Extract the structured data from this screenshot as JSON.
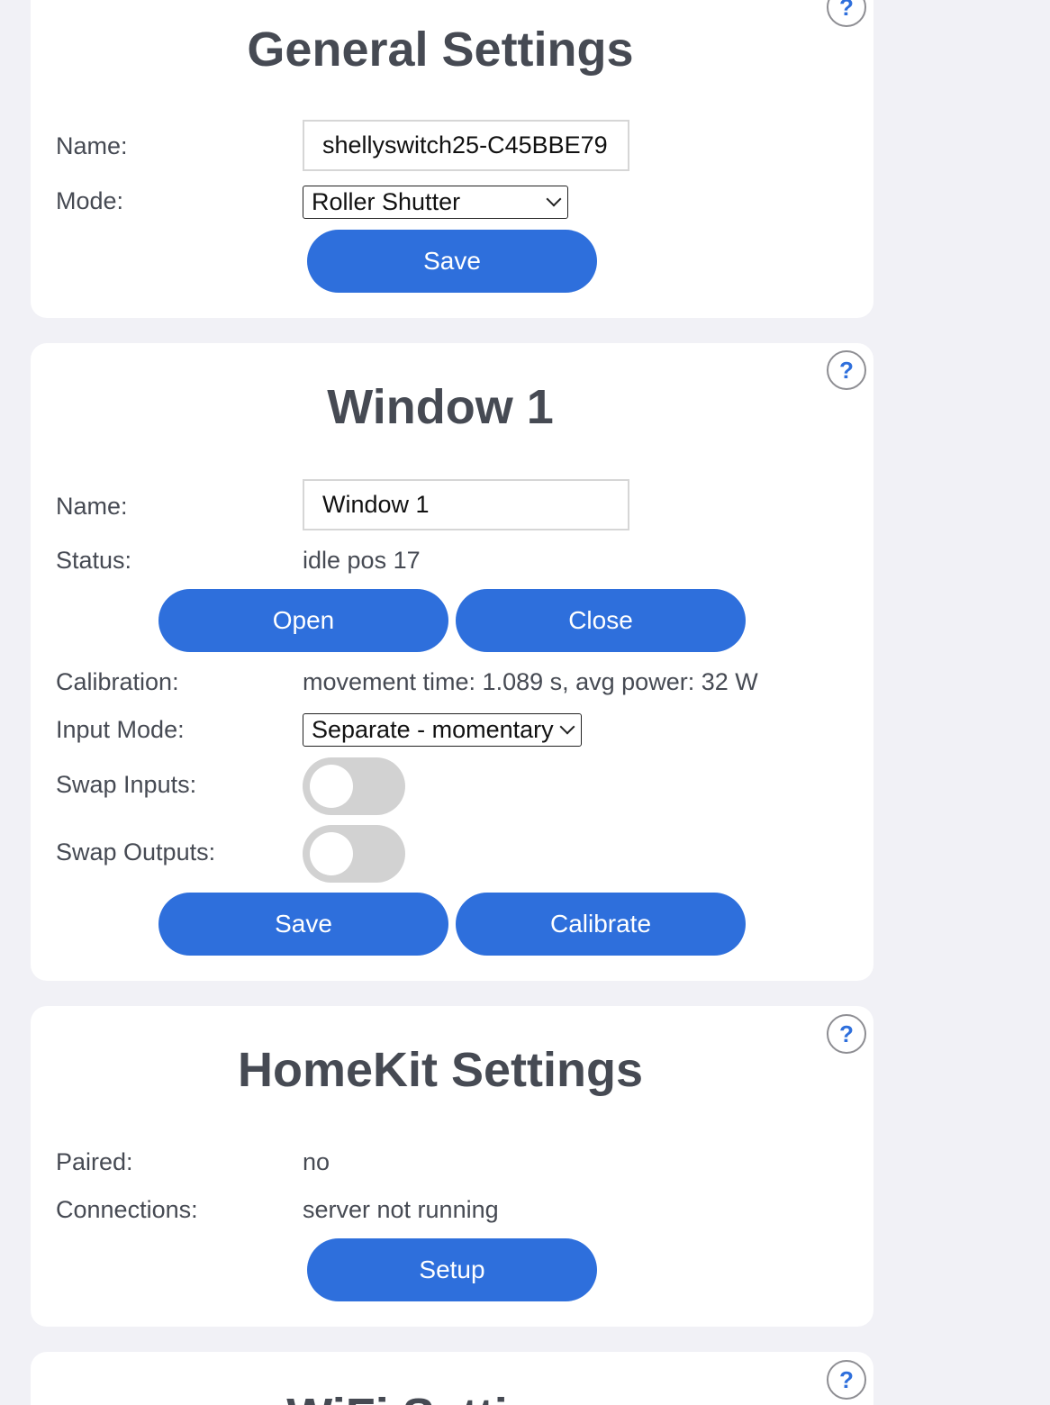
{
  "help_symbol": "?",
  "general": {
    "title": "General Settings",
    "name_label": "Name:",
    "name_value": "shellyswitch25-C45BBE79",
    "mode_label": "Mode:",
    "mode_value": "Roller Shutter",
    "save_label": "Save"
  },
  "window": {
    "title": "Window 1",
    "name_label": "Name:",
    "name_value": "Window 1",
    "status_label": "Status:",
    "status_value": "idle pos 17",
    "open_label": "Open",
    "close_label": "Close",
    "calibration_label": "Calibration:",
    "calibration_value": "movement time: 1.089 s, avg power: 32 W",
    "input_mode_label": "Input Mode:",
    "input_mode_value": "Separate - momentary",
    "swap_inputs_label": "Swap Inputs:",
    "swap_inputs_on": false,
    "swap_outputs_label": "Swap Outputs:",
    "swap_outputs_on": false,
    "save_label": "Save",
    "calibrate_label": "Calibrate"
  },
  "homekit": {
    "title": "HomeKit Settings",
    "paired_label": "Paired:",
    "paired_value": "no",
    "connections_label": "Connections:",
    "connections_value": "server not running",
    "setup_label": "Setup"
  },
  "wifi": {
    "title": "WiFi Settings"
  },
  "colors": {
    "accent": "#2e6fdc",
    "background": "#f1f1f6",
    "card": "#ffffff",
    "text": "#464a53",
    "toggle_off": "#d2d2d2"
  }
}
